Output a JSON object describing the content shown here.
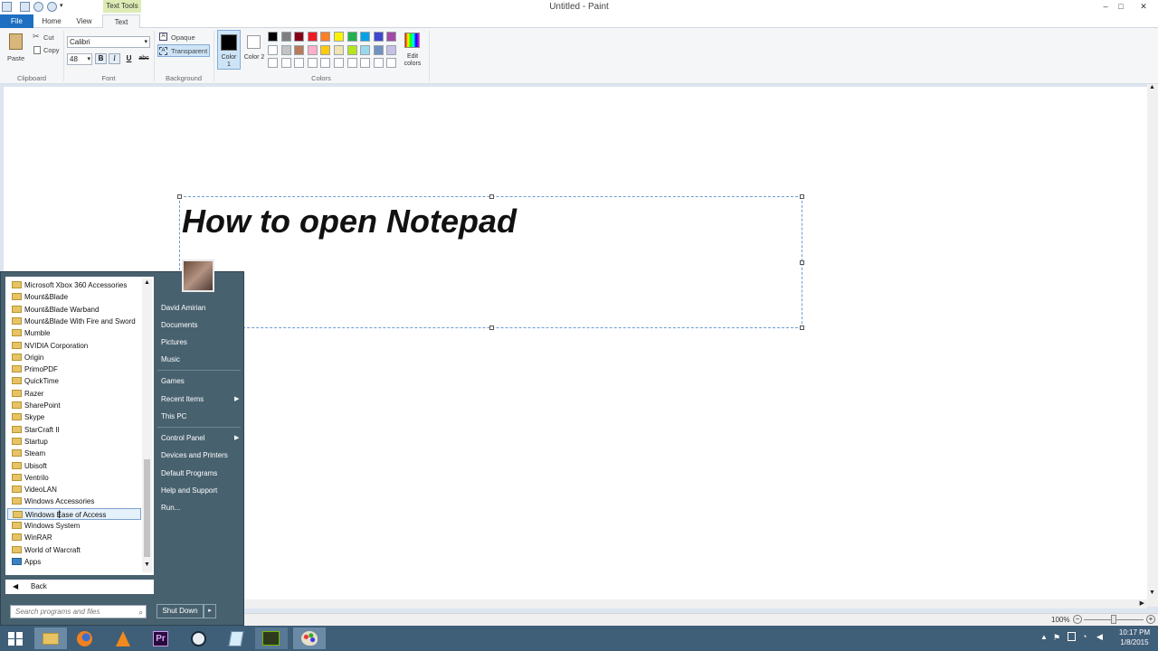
{
  "window": {
    "title": "Untitled - Paint",
    "context_tab_label": "Text Tools",
    "minimize_glyph": "–",
    "maximize_glyph": "□",
    "close_glyph": "✕"
  },
  "tabs": [
    "File",
    "Home",
    "View",
    "Text"
  ],
  "ribbon": {
    "clipboard": {
      "paste": "Paste",
      "cut": "Cut",
      "copy": "Copy",
      "label": "Clipboard"
    },
    "font": {
      "family": "Calibri",
      "size": "48",
      "bold": "B",
      "italic": "I",
      "underline": "U",
      "strike": "abc",
      "label": "Font"
    },
    "background": {
      "opaque": "Opaque",
      "transparent": "Transparent",
      "label": "Background"
    },
    "color1_label": "Color 1",
    "color2_label": "Color 2",
    "edit_colors_label": "Edit colors",
    "colors_label": "Colors",
    "palette_row1": [
      "#000000",
      "#7f7f7f",
      "#880015",
      "#ed1c24",
      "#ff7f27",
      "#fff200",
      "#22b14c",
      "#00a2e8",
      "#3f48cc",
      "#a349a4"
    ],
    "palette_row2": [
      "#ffffff",
      "#c3c3c3",
      "#b97a57",
      "#ffaec9",
      "#ffc90e",
      "#efe4b0",
      "#b5e61d",
      "#99d9ea",
      "#7092be",
      "#c8bfe7"
    ],
    "color1": "#000000",
    "color2": "#ffffff"
  },
  "canvas": {
    "text": "How to open Notepad"
  },
  "statusbar": {
    "zoom": "100%"
  },
  "start_menu": {
    "programs": [
      "Microsoft Xbox 360 Accessories",
      "Mount&Blade",
      "Mount&Blade Warband",
      "Mount&Blade With Fire and Sword",
      "Mumble",
      "NVIDIA Corporation",
      "Origin",
      "PrimoPDF",
      "QuickTime",
      "Razer",
      "SharePoint",
      "Skype",
      "StarCraft II",
      "Startup",
      "Steam",
      "Ubisoft",
      "Ventrilo",
      "VideoLAN",
      "Windows Accessories",
      "Windows Ease of Access",
      "Windows System",
      "WinRAR",
      "World of Warcraft",
      "Apps"
    ],
    "selected_program": "Windows Ease of Access",
    "back": "Back",
    "search_placeholder": "Search programs and files",
    "right": {
      "user": "David Amirian",
      "documents": "Documents",
      "pictures": "Pictures",
      "music": "Music",
      "games": "Games",
      "recent_items": "Recent Items",
      "this_pc": "This PC",
      "control_panel": "Control Panel",
      "devices_printers": "Devices and Printers",
      "default_programs": "Default Programs",
      "help_support": "Help and Support",
      "run": "Run..."
    },
    "shutdown": "Shut Down"
  },
  "taskbar": {
    "time": "10:17 PM",
    "date": "1/8/2015",
    "apps": [
      "start-icon",
      "file-explorer-icon",
      "firefox-icon",
      "vlc-icon",
      "premiere-icon",
      "steam-icon",
      "notepad-icon",
      "nvidia-icon",
      "paint-icon"
    ]
  }
}
